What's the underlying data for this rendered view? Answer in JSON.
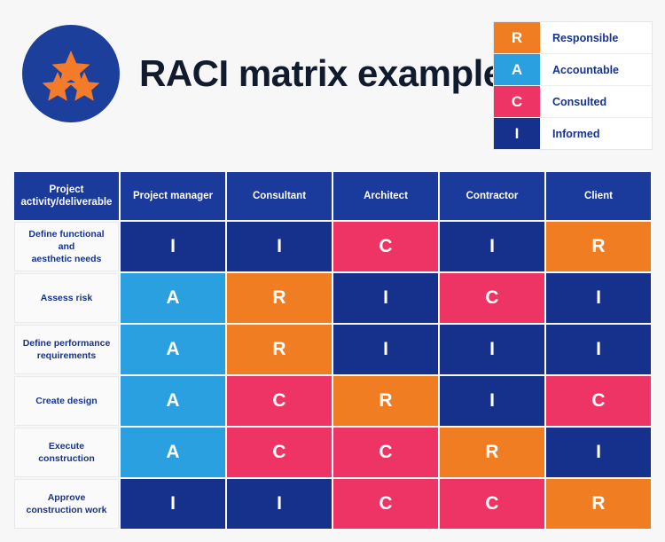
{
  "header": {
    "title": "RACI matrix example",
    "logo": {
      "icon": "three-stars-circle-logo",
      "circle_color": "#1c3f9b",
      "star_color": "#f47b29"
    }
  },
  "legend": {
    "items": [
      {
        "key": "R",
        "label": "Responsible",
        "color": "#f07d22"
      },
      {
        "key": "A",
        "label": "Accountable",
        "color": "#2ba0e0"
      },
      {
        "key": "C",
        "label": "Consulted",
        "color": "#ee3465"
      },
      {
        "key": "I",
        "label": "Informed",
        "color": "#15318b"
      }
    ]
  },
  "matrix": {
    "columns": [
      "Project activity/deliverable",
      "Project manager",
      "Consultant",
      "Architect",
      "Contractor",
      "Client"
    ],
    "column_header_first_line": "Project",
    "column_header_second_line": "activity/deliverable",
    "rows": [
      {
        "activity": "Define functional and aesthetic needs",
        "activity_lines": [
          "Define functional",
          "and",
          "aesthetic needs"
        ],
        "values": [
          "I",
          "I",
          "C",
          "I",
          "R"
        ]
      },
      {
        "activity": "Assess risk",
        "activity_lines": [
          "Assess risk"
        ],
        "values": [
          "A",
          "R",
          "I",
          "C",
          "I"
        ]
      },
      {
        "activity": "Define performance requirements",
        "activity_lines": [
          "Define performance",
          "requirements"
        ],
        "values": [
          "A",
          "R",
          "I",
          "I",
          "I"
        ]
      },
      {
        "activity": "Create design",
        "activity_lines": [
          "Create design"
        ],
        "values": [
          "A",
          "C",
          "R",
          "I",
          "C"
        ]
      },
      {
        "activity": "Execute construction",
        "activity_lines": [
          "Execute",
          "construction"
        ],
        "values": [
          "A",
          "C",
          "C",
          "R",
          "I"
        ]
      },
      {
        "activity": "Approve construction work",
        "activity_lines": [
          "Approve",
          "construction work"
        ],
        "values": [
          "I",
          "I",
          "C",
          "C",
          "R"
        ]
      }
    ]
  },
  "theme": {
    "page_background": "#f7f7f8",
    "header_cell_background": "#1a3a9c",
    "row_label_background": "#fafafa",
    "title_color": "#111b2e",
    "legend_label_color": "#16338e"
  }
}
